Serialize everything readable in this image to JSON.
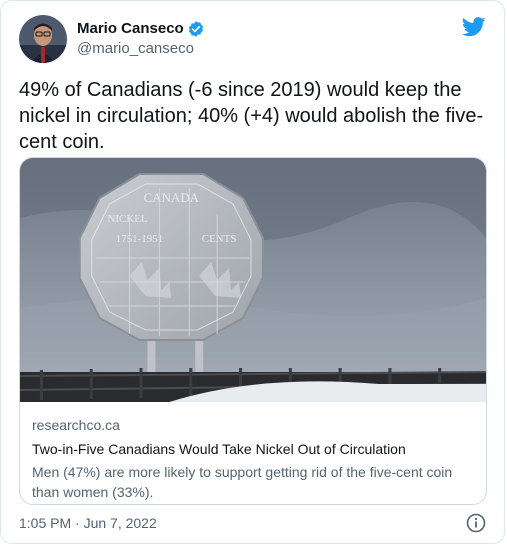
{
  "author": {
    "display_name": "Mario Canseco",
    "handle": "@mario_canseco",
    "verified": true,
    "avatar_icon": "avatar-photo"
  },
  "tweet": {
    "text": "49% of Canadians (-6 since 2019) would keep the nickel in circulation; 40% (+4) would abolish the five-cent coin.",
    "timestamp": "1:05 PM · Jun 7, 2022"
  },
  "card": {
    "domain": "researchco.ca",
    "title": "Two-in-Five Canadians Would Take Nickel Out of Circulation",
    "description": "Men (47%) are more likely to support getting rid of the five-cent coin than women (33%).",
    "image_icon": "big-nickel-photo",
    "coin_text_top": "CANADA",
    "coin_text_left": "NICKEL",
    "coin_text_years": "1751-1951",
    "coin_text_right": "CENTS"
  },
  "icons": {
    "bird": "twitter-bird-icon",
    "verified": "verified-badge-icon",
    "info": "info-icon"
  },
  "colors": {
    "twitter_blue": "#1d9bf0",
    "text_primary": "#0f1419",
    "text_secondary": "#536471",
    "border": "#cfd9de"
  }
}
